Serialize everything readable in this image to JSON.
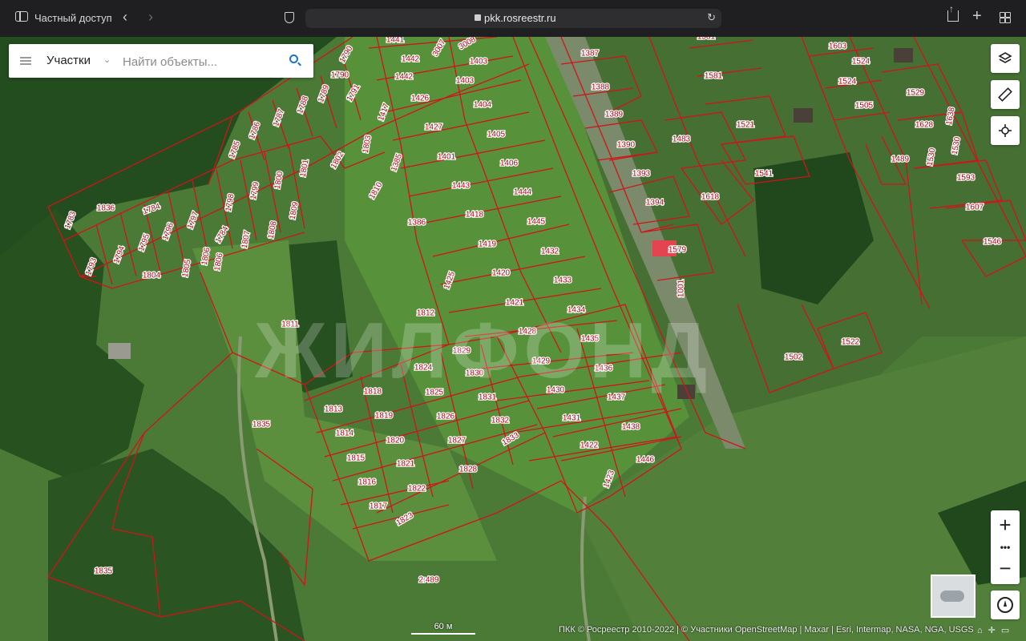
{
  "browser": {
    "mode_label": "Частный доступ",
    "url": "pkk.rosreestr.ru",
    "icons": [
      "sidebar-icon",
      "back-icon",
      "forward-icon",
      "shield-icon",
      "lock-icon",
      "reload-icon",
      "share-icon",
      "new-tab-icon",
      "tabs-overview-icon"
    ]
  },
  "search": {
    "layer_label": "Участки",
    "placeholder": "Найти объекты..."
  },
  "map": {
    "watermark": "ЖИЛФОНД",
    "scale_label": "60 м",
    "attribution": "ПКК © Росреестр 2010-2022 | © Участники OpenStreetMap | Maxar | Esri, Intermap, NASA, NGA, USGS",
    "parcel_color": "#d0141a",
    "parcels": [
      {
        "id": "1441",
        "t": "1441"
      },
      {
        "id": "3007",
        "t": "3007"
      },
      {
        "id": "3008",
        "t": "3008"
      },
      {
        "id": "1790a",
        "t": "1790"
      },
      {
        "id": "1442a",
        "t": "1442"
      },
      {
        "id": "1403a",
        "t": "1403"
      },
      {
        "id": "1790b",
        "t": "1790"
      },
      {
        "id": "1442b",
        "t": "1442"
      },
      {
        "id": "1403b",
        "t": "1403"
      },
      {
        "id": "1791",
        "t": "1791"
      },
      {
        "id": "1789",
        "t": "1789"
      },
      {
        "id": "1788",
        "t": "1788"
      },
      {
        "id": "1787",
        "t": "1787"
      },
      {
        "id": "1786",
        "t": "1786"
      },
      {
        "id": "1785",
        "t": "1785"
      },
      {
        "id": "1417",
        "t": "1417"
      },
      {
        "id": "1426",
        "t": "1426"
      },
      {
        "id": "1404",
        "t": "1404"
      },
      {
        "id": "1427",
        "t": "1427"
      },
      {
        "id": "1405",
        "t": "1405"
      },
      {
        "id": "1803",
        "t": "1803"
      },
      {
        "id": "1802",
        "t": "1802"
      },
      {
        "id": "1801",
        "t": "1801"
      },
      {
        "id": "1800",
        "t": "1800"
      },
      {
        "id": "1799",
        "t": "1799"
      },
      {
        "id": "1798",
        "t": "1798"
      },
      {
        "id": "1385",
        "t": "1385"
      },
      {
        "id": "1401",
        "t": "1401"
      },
      {
        "id": "1406",
        "t": "1406"
      },
      {
        "id": "1810",
        "t": "1810"
      },
      {
        "id": "1443",
        "t": "1443"
      },
      {
        "id": "1444",
        "t": "1444"
      },
      {
        "id": "1783",
        "t": "1783"
      },
      {
        "id": "1836",
        "t": "1836"
      },
      {
        "id": "1784a",
        "t": "1784"
      },
      {
        "id": "1797",
        "t": "1797"
      },
      {
        "id": "1796",
        "t": "1796"
      },
      {
        "id": "1795",
        "t": "1795"
      },
      {
        "id": "1794",
        "t": "1794"
      },
      {
        "id": "1793",
        "t": "1793"
      },
      {
        "id": "1784b",
        "t": "1784"
      },
      {
        "id": "1807",
        "t": "1807"
      },
      {
        "id": "1808",
        "t": "1808"
      },
      {
        "id": "1809",
        "t": "1809"
      },
      {
        "id": "1805",
        "t": "1805"
      },
      {
        "id": "1806a",
        "t": "1806"
      },
      {
        "id": "1806b",
        "t": "1806"
      },
      {
        "id": "1804",
        "t": "1804"
      },
      {
        "id": "1386",
        "t": "1386"
      },
      {
        "id": "1418",
        "t": "1418"
      },
      {
        "id": "1445",
        "t": "1445"
      },
      {
        "id": "1419",
        "t": "1419"
      },
      {
        "id": "1432",
        "t": "1432"
      },
      {
        "id": "1420",
        "t": "1420"
      },
      {
        "id": "1433",
        "t": "1433"
      },
      {
        "id": "1425",
        "t": "1425"
      },
      {
        "id": "1421",
        "t": "1421"
      },
      {
        "id": "1434",
        "t": "1434"
      },
      {
        "id": "1812",
        "t": "1812"
      },
      {
        "id": "1428",
        "t": "1428"
      },
      {
        "id": "1435",
        "t": "1435"
      },
      {
        "id": "1811",
        "t": "1811"
      },
      {
        "id": "1829",
        "t": "1829"
      },
      {
        "id": "1429",
        "t": "1429"
      },
      {
        "id": "1824",
        "t": "1824"
      },
      {
        "id": "1830",
        "t": "1830"
      },
      {
        "id": "1436",
        "t": "1436"
      },
      {
        "id": "1818",
        "t": "1818"
      },
      {
        "id": "1825",
        "t": "1825"
      },
      {
        "id": "1831",
        "t": "1831"
      },
      {
        "id": "1430",
        "t": "1430"
      },
      {
        "id": "1437",
        "t": "1437"
      },
      {
        "id": "1813",
        "t": "1813"
      },
      {
        "id": "1819",
        "t": "1819"
      },
      {
        "id": "1826",
        "t": "1826"
      },
      {
        "id": "1832",
        "t": "1832"
      },
      {
        "id": "1431",
        "t": "1431"
      },
      {
        "id": "1438",
        "t": "1438"
      },
      {
        "id": "1835a",
        "t": "1835"
      },
      {
        "id": "1814",
        "t": "1814"
      },
      {
        "id": "1820",
        "t": "1820"
      },
      {
        "id": "1827",
        "t": "1827"
      },
      {
        "id": "1833",
        "t": "1833"
      },
      {
        "id": "1422",
        "t": "1422"
      },
      {
        "id": "1815",
        "t": "1815"
      },
      {
        "id": "1821",
        "t": "1821"
      },
      {
        "id": "1828",
        "t": "1828"
      },
      {
        "id": "1446",
        "t": "1446"
      },
      {
        "id": "1423",
        "t": "1423"
      },
      {
        "id": "1816",
        "t": "1816"
      },
      {
        "id": "1822",
        "t": "1822"
      },
      {
        "id": "1817",
        "t": "1817"
      },
      {
        "id": "1823",
        "t": "1823"
      },
      {
        "id": "1835b",
        "t": "1835"
      },
      {
        "id": "2489",
        "t": "2:489"
      },
      {
        "id": "1387",
        "t": "1387"
      },
      {
        "id": "1388",
        "t": "1388"
      },
      {
        "id": "1389",
        "t": "1389"
      },
      {
        "id": "1390",
        "t": "1390"
      },
      {
        "id": "1393",
        "t": "1393"
      },
      {
        "id": "1394",
        "t": "1394"
      },
      {
        "id": "1579",
        "t": "1579"
      },
      {
        "id": "1001",
        "t": "1001"
      },
      {
        "id": "1581a",
        "t": "1581"
      },
      {
        "id": "1581b",
        "t": "1581"
      },
      {
        "id": "1521",
        "t": "1521"
      },
      {
        "id": "1483",
        "t": "1483"
      },
      {
        "id": "1541",
        "t": "1541"
      },
      {
        "id": "1618",
        "t": "1618"
      },
      {
        "id": "1603",
        "t": "1603"
      },
      {
        "id": "1524a",
        "t": "1524"
      },
      {
        "id": "1524b",
        "t": "1524"
      },
      {
        "id": "1505",
        "t": "1505"
      },
      {
        "id": "1529",
        "t": "1529"
      },
      {
        "id": "1628",
        "t": "1628"
      },
      {
        "id": "1638",
        "t": "1638"
      },
      {
        "id": "1489",
        "t": "1489"
      },
      {
        "id": "1530a",
        "t": "1530"
      },
      {
        "id": "1530b",
        "t": "1530"
      },
      {
        "id": "1593",
        "t": "1593"
      },
      {
        "id": "1607",
        "t": "1607"
      },
      {
        "id": "1546",
        "t": "1546"
      },
      {
        "id": "1502",
        "t": "1502"
      },
      {
        "id": "1522",
        "t": "1522"
      }
    ]
  },
  "controls": {
    "icons": [
      "layers-icon",
      "ruler-icon",
      "locate-icon",
      "zoom-in-icon",
      "zoom-more-icon",
      "zoom-out-icon",
      "compass-icon",
      "basemap-thumbnail"
    ],
    "zoom_in": "+",
    "zoom_more": "•••",
    "zoom_out": "−"
  }
}
